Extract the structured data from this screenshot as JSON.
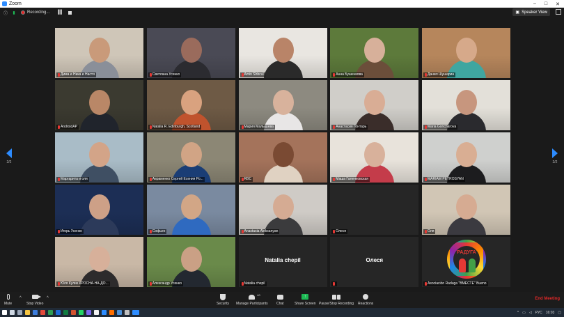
{
  "window": {
    "title": "Zoom"
  },
  "meeting_bar": {
    "recording_label": "Recording...",
    "speaker_view_label": "Speaker View"
  },
  "navigation": {
    "left_page": "2/2",
    "right_page": "2/2"
  },
  "tiles": [
    {
      "name": "Дима и Ника и Настя",
      "muted": true,
      "bg": "#cfc6b8",
      "face": "#c99a7a",
      "shirt": "#8a8f99",
      "hasVideo": true
    },
    {
      "name": "Светлана Усенко",
      "muted": true,
      "bg": "#4a4a55",
      "face": "#9a6b5c",
      "shirt": "#2b2b30",
      "hasVideo": true
    },
    {
      "name": "Amin Shbcul",
      "muted": true,
      "bg": "#e9e6e1",
      "face": "#b98468",
      "shirt": "#2a2a2a",
      "hasVideo": true
    },
    {
      "name": "Анна Бушенкова",
      "muted": true,
      "bg": "#5d7a3b",
      "face": "#d7b09a",
      "shirt": "#6b4e3a",
      "hasVideo": true
    },
    {
      "name": "Данил Шушарин",
      "muted": true,
      "bg": "#b6865c",
      "face": "#d6a98a",
      "shirt": "#3fa6a0",
      "hasVideo": true
    },
    {
      "name": "AndroidAP",
      "muted": true,
      "bg": "#3b3a30",
      "face": "#b98767",
      "shirt": "#20242c",
      "hasVideo": true
    },
    {
      "name": "Natalia R.  Edinburgh, Scotland",
      "muted": true,
      "bg": "#6e5a45",
      "face": "#d9a27f",
      "shirt": "#c0532d",
      "hasVideo": true
    },
    {
      "name": "Мария Малышева",
      "muted": true,
      "bg": "#8d8a80",
      "face": "#d8b29c",
      "shirt": "#e8e6e6",
      "hasVideo": true
    },
    {
      "name": "Анастасия Гонтарь",
      "muted": true,
      "bg": "#d0cec9",
      "face": "#d9ad95",
      "shirt": "#3a2d2a",
      "hasVideo": true
    },
    {
      "name": "Maria Goncharova",
      "muted": true,
      "bg": "#e3e0d9",
      "face": "#c7967e",
      "shirt": "#2a2a2e",
      "hasVideo": true
    },
    {
      "name": "Маргарита и оля",
      "muted": true,
      "bg": "#a9bcc7",
      "face": "#d3a488",
      "shirt": "#3f4f63",
      "hasVideo": true
    },
    {
      "name": "Авраменко Сергей Есения Ро...",
      "muted": true,
      "bg": "#8c8775",
      "face": "#d1a485",
      "shirt": "#1a3d75",
      "hasVideo": true
    },
    {
      "name": "RBC",
      "muted": true,
      "bg": "#a4735b",
      "face": "#7a4a33",
      "shirt": "#e0d2c2",
      "hasVideo": true
    },
    {
      "name": "Маша Галенковская",
      "muted": true,
      "bg": "#e8e3db",
      "face": "#d8b19b",
      "shirt": "#c43c4a",
      "hasVideo": true
    },
    {
      "name": "MARIAM PETROSYAN",
      "muted": true,
      "bg": "#cfd0ce",
      "face": "#d9ae93",
      "shirt": "#1c1c1e",
      "hasVideo": true
    },
    {
      "name": "Игорь Усенко",
      "muted": true,
      "bg": "#1c2e55",
      "face": "#cda087",
      "shirt": "#2c3a5a",
      "hasVideo": true
    },
    {
      "name": "Софьен",
      "muted": true,
      "bg": "#7a8aa0",
      "face": "#d2a686",
      "shirt": "#2f6ac0",
      "hasVideo": true
    },
    {
      "name": "Anastasia Aleksanyan",
      "muted": true,
      "bg": "#cfcbc6",
      "face": "#d5ab93",
      "shirt": "#3b3b3d",
      "hasVideo": true
    },
    {
      "name": "Олеся",
      "muted": true,
      "bg": "#262626",
      "face": "",
      "shirt": "",
      "hasVideo": false
    },
    {
      "name": "Оля",
      "muted": true,
      "bg": "#d1c6b5",
      "face": "#d6ab92",
      "shirt": "#3b3a40",
      "hasVideo": true
    },
    {
      "name": "Юля Кулик КРОСНА-НА-ДО...",
      "muted": true,
      "bg": "#c9b8a6",
      "face": "#d7b09a",
      "shirt": "#2d2b2c",
      "hasVideo": true
    },
    {
      "name": "Александр Усенко",
      "muted": true,
      "bg": "#6a8a4a",
      "face": "#caa085",
      "shirt": "#232830",
      "hasVideo": true
    },
    {
      "name": "Natalia chepil",
      "muted": true,
      "bg": "#262626",
      "face": "",
      "shirt": "",
      "hasVideo": false,
      "bigName": "Natalia chepil"
    },
    {
      "name": "",
      "muted": true,
      "bg": "#262626",
      "face": "",
      "shirt": "",
      "hasVideo": false,
      "bigName": "Олеся"
    },
    {
      "name": "Asociación Raduga \"ВМЕСТЕ\" Bueno",
      "muted": true,
      "bg": "#262626",
      "face": "",
      "shirt": "",
      "hasVideo": false,
      "logo": true
    }
  ],
  "logo_text": "РАДУГА",
  "toolbar": {
    "mute": "Mute",
    "stop_video": "Stop Video",
    "security": "Security",
    "manage_participants": "Manage Participants",
    "participants_count": "40",
    "chat": "Chat",
    "share_screen": "Share Screen",
    "pause_stop_recording": "Pause/Stop Recording",
    "reactions": "Reactions",
    "end_meeting": "End Meeting"
  },
  "taskbar": {
    "lang": "РУС",
    "time": "16:03"
  },
  "colors": {
    "accent": "#2d8cff",
    "end": "#e02828",
    "share": "#1db954"
  }
}
